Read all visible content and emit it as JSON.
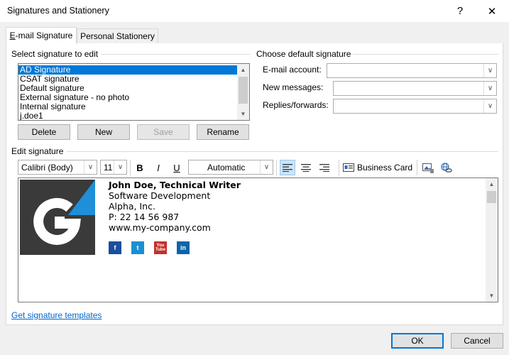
{
  "window": {
    "title": "Signatures and Stationery",
    "help_label": "?",
    "close_label": "✕"
  },
  "tabs": [
    {
      "label": "E-mail Signature",
      "active": true
    },
    {
      "label": "Personal Stationery",
      "active": false
    }
  ],
  "select_group": {
    "label": "Select signature to edit",
    "items": [
      "AD Signature",
      "CSAT signature",
      "Default signature",
      "External signature - no photo",
      "Internal signature",
      "j.doe1"
    ],
    "selected": "AD Signature"
  },
  "list_buttons": {
    "delete": "Delete",
    "new": "New",
    "save": "Save",
    "rename": "Rename"
  },
  "default_group": {
    "label": "Choose default signature",
    "email_account_label": "E-mail account:",
    "email_account_value": "",
    "new_messages_label": "New messages:",
    "new_messages_value": "",
    "replies_label": "Replies/forwards:",
    "replies_value": ""
  },
  "edit_group": {
    "label": "Edit signature",
    "font": "Calibri (Body)",
    "size": "11",
    "bold": "B",
    "italic": "I",
    "underline": "U",
    "color": "Automatic",
    "business_card": "Business Card"
  },
  "signature": {
    "name_line": "John Doe, Technical Writer",
    "dept": "Software Development",
    "company": "Alpha, Inc.",
    "phone": "P: 22 14 56 987",
    "website": "www.my-company.com",
    "social": [
      "facebook-icon",
      "twitter-icon",
      "youtube-icon",
      "linkedin-icon"
    ],
    "social_labels": {
      "facebook": "f",
      "twitter": "t",
      "youtube": "You Tube",
      "linkedin": "in"
    },
    "social_colors": {
      "facebook": "#1a4f9c",
      "twitter": "#1b8fd1",
      "youtube": "#c4302b",
      "linkedin": "#0a66a8"
    },
    "logo_colors": {
      "dark": "#3a3a3a",
      "accent": "#1e8fd8"
    }
  },
  "footer": {
    "templates_link": "Get signature templates",
    "ok": "OK",
    "cancel": "Cancel"
  }
}
